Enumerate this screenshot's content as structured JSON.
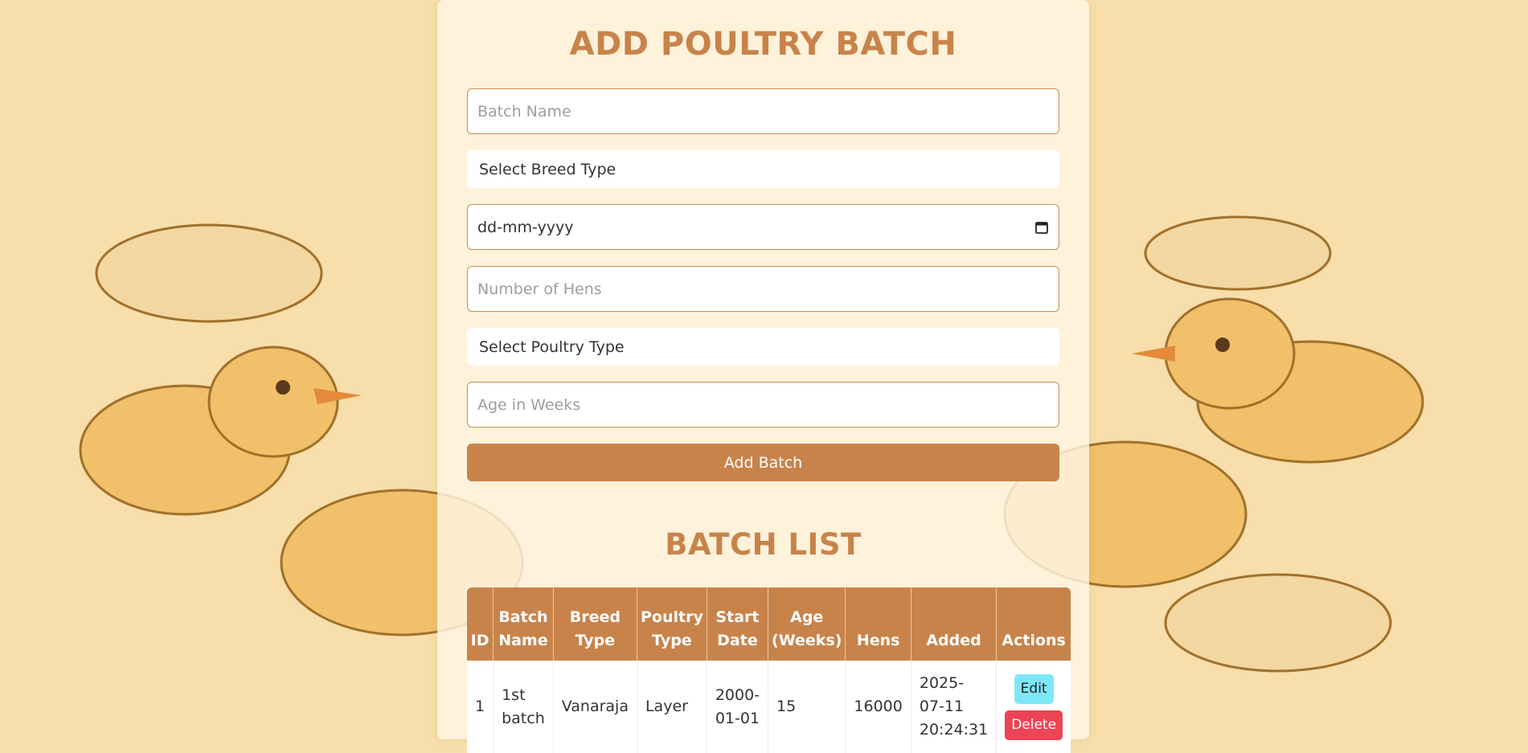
{
  "form": {
    "title": "ADD POULTRY BATCH",
    "batch_name_placeholder": "Batch Name",
    "breed_type_select": "Select Breed Type",
    "date_placeholder": "dd-mm-yyyy",
    "hens_placeholder": "Number of Hens",
    "poultry_type_select": "Select Poultry Type",
    "age_placeholder": "Age in Weeks",
    "submit_label": "Add Batch"
  },
  "list": {
    "title": "BATCH LIST",
    "columns": [
      "ID",
      "Batch Name",
      "Breed Type",
      "Poultry Type",
      "Start Date",
      "Age (Weeks)",
      "Hens",
      "Added",
      "Actions"
    ],
    "rows": [
      {
        "id": "1",
        "batch_name": "1st batch",
        "breed_type": "Vanaraja",
        "poultry_type": "Layer",
        "start_date": "2000-01-01",
        "age_weeks": "15",
        "hens": "16000",
        "added": "2025-07-11 20:24:31",
        "edit_label": "Edit",
        "delete_label": "Delete"
      }
    ]
  },
  "icons": {
    "calendar": "calendar-icon",
    "background": "chick-illustration"
  },
  "colors": {
    "accent": "#c8834a",
    "edit": "#7ee7f7",
    "delete": "#eb4455",
    "page_bg": "#f7deaa"
  }
}
